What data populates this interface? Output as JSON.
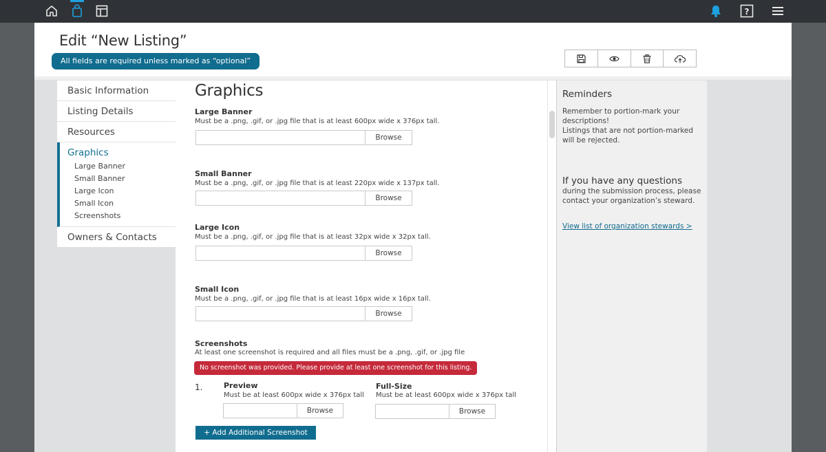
{
  "icons": {
    "home": "home-icon",
    "bag": "shopping-bag-icon",
    "layout": "layout-icon",
    "bell": "bell-icon",
    "help": "help-icon",
    "menu": "hamburger-menu-icon",
    "save": "save-icon",
    "preview": "eye-icon",
    "delete": "trash-icon",
    "submit": "cloud-upload-icon"
  },
  "colors": {
    "accent": "#116d8f",
    "error": "#c52a3b",
    "topbar": "#2f3236",
    "active_icon": "#1fa0df"
  },
  "header": {
    "title": "Edit “New Listing”",
    "required_note": "All fields are required unless marked as “optional”"
  },
  "nav": {
    "items": [
      {
        "label": "Basic Information"
      },
      {
        "label": "Listing Details"
      },
      {
        "label": "Resources"
      }
    ],
    "active": {
      "label": "Graphics",
      "subitems": [
        "Large Banner",
        "Small Banner",
        "Large Icon",
        "Small Icon",
        "Screenshots"
      ]
    },
    "after": [
      {
        "label": "Owners & Contacts"
      }
    ]
  },
  "main": {
    "heading": "Graphics",
    "browse_label": "Browse",
    "large_banner": {
      "label": "Large Banner",
      "help": "Must be a .png, .gif, or .jpg file that is at least 600px wide x 376px tall."
    },
    "small_banner": {
      "label": "Small Banner",
      "help": "Must be a .png, .gif, or .jpg file that is at least 220px wide x 137px tall."
    },
    "large_icon": {
      "label": "Large Icon",
      "help": "Must be a .png, .gif, or .jpg file that is at least 32px wide x 32px tall."
    },
    "small_icon": {
      "label": "Small Icon",
      "help": "Must be a .png, .gif, or .jpg file that is at least 16px wide x 16px tall."
    },
    "screenshots": {
      "label": "Screenshots",
      "help": "At least one screenshot is required and all files must be a .png, .gif, or .jpg file",
      "error": "No screenshot was provided. Please provide at least one screenshot for this listing.",
      "number": "1.",
      "preview_label": "Preview",
      "preview_help": "Must be at least 600px wide x 376px tall",
      "fullsize_label": "Full-Size",
      "fullsize_help": "Must be at least 600px wide x 376px tall",
      "add_button": "+ Add Additional Screenshot"
    }
  },
  "sidebar": {
    "reminders_title": "Reminders",
    "reminders_text": "Remember to portion-mark your descriptions!",
    "reminders_text2": "Listings that are not portion-marked will be rejected.",
    "questions_title": "If you have any questions",
    "questions_text": "during the submission process, please contact your organization’s steward.",
    "stewards_link": "View list of organization stewards >"
  }
}
